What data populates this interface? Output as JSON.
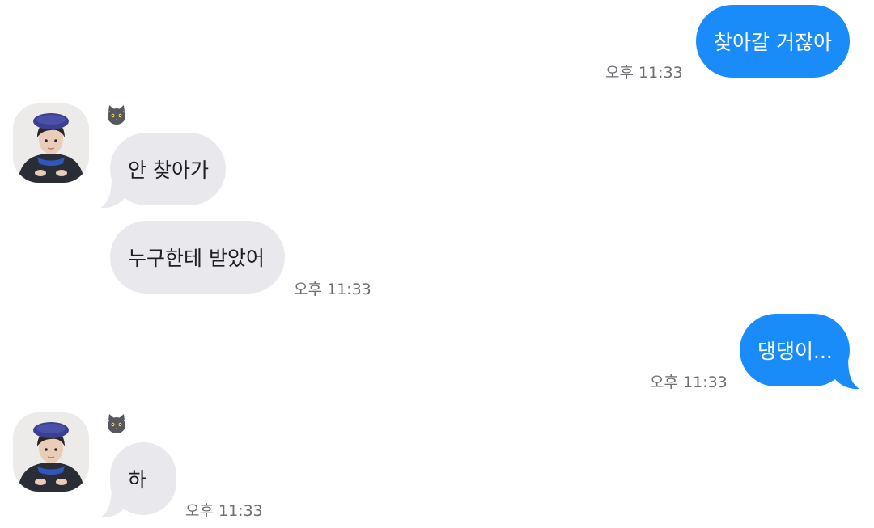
{
  "conversation": {
    "messages": [
      {
        "direction": "sent",
        "text": "찾아갈 거잖아",
        "time": "오후 11:33"
      },
      {
        "direction": "received",
        "text": "안 찾아가",
        "time": ""
      },
      {
        "direction": "received",
        "text": "누구한테 받았어",
        "time": "오후 11:33"
      },
      {
        "direction": "sent",
        "text": "댕댕이...",
        "time": "오후 11:33"
      },
      {
        "direction": "received",
        "text": "하",
        "time": "오후 11:33"
      }
    ],
    "sender": {
      "icon": "cat-face-icon",
      "avatar": "profile-photo"
    }
  },
  "colors": {
    "sent_bubble": "#1a8cfa",
    "received_bubble": "#e9e9ed",
    "timestamp": "#6e6e72"
  }
}
